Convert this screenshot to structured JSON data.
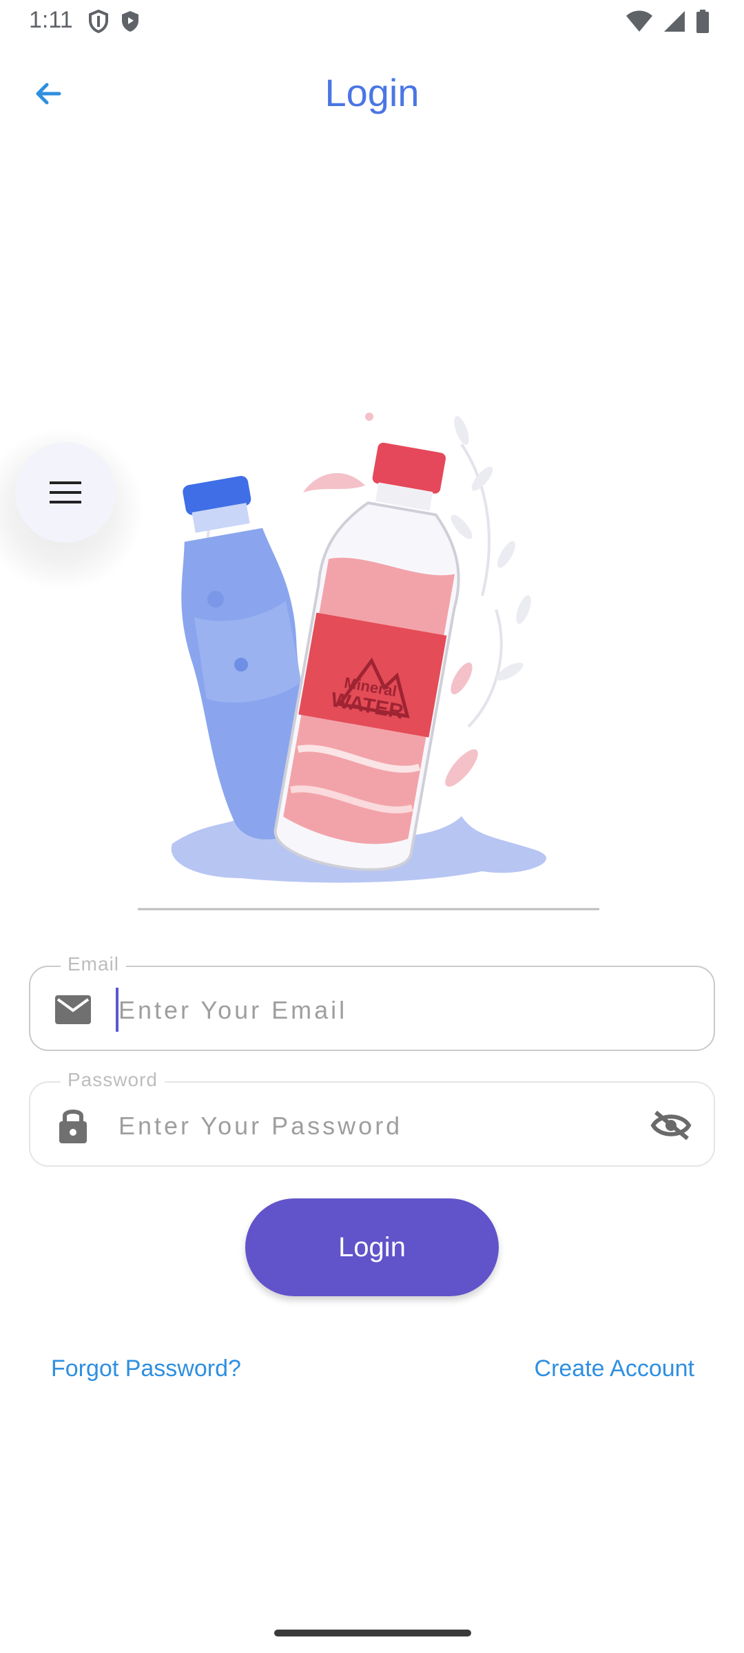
{
  "status_bar": {
    "time": "1:11",
    "left_icons": [
      "shield-outline-icon",
      "shield-play-icon"
    ],
    "right_icons": [
      "wifi-icon",
      "cell-signal-icon",
      "battery-icon"
    ]
  },
  "app_bar": {
    "title": "Login",
    "back_icon": "arrow-back-icon"
  },
  "fab": {
    "icon": "menu-icon"
  },
  "illustration": {
    "label_line1": "Mineral",
    "label_line2": "WATER"
  },
  "form": {
    "email": {
      "label": "Email",
      "placeholder": "Enter Your Email",
      "value": "",
      "icon": "mail-icon"
    },
    "password": {
      "label": "Password",
      "placeholder": "Enter Your Password",
      "value": "",
      "icon": "lock-icon",
      "toggle_icon": "eye-off-icon"
    },
    "login_button": "Login",
    "forgot_link": "Forgot Password?",
    "create_link": "Create Account"
  },
  "colors": {
    "accent": "#4a76e4",
    "button": "#6153c9",
    "link": "#2f8fe0"
  }
}
